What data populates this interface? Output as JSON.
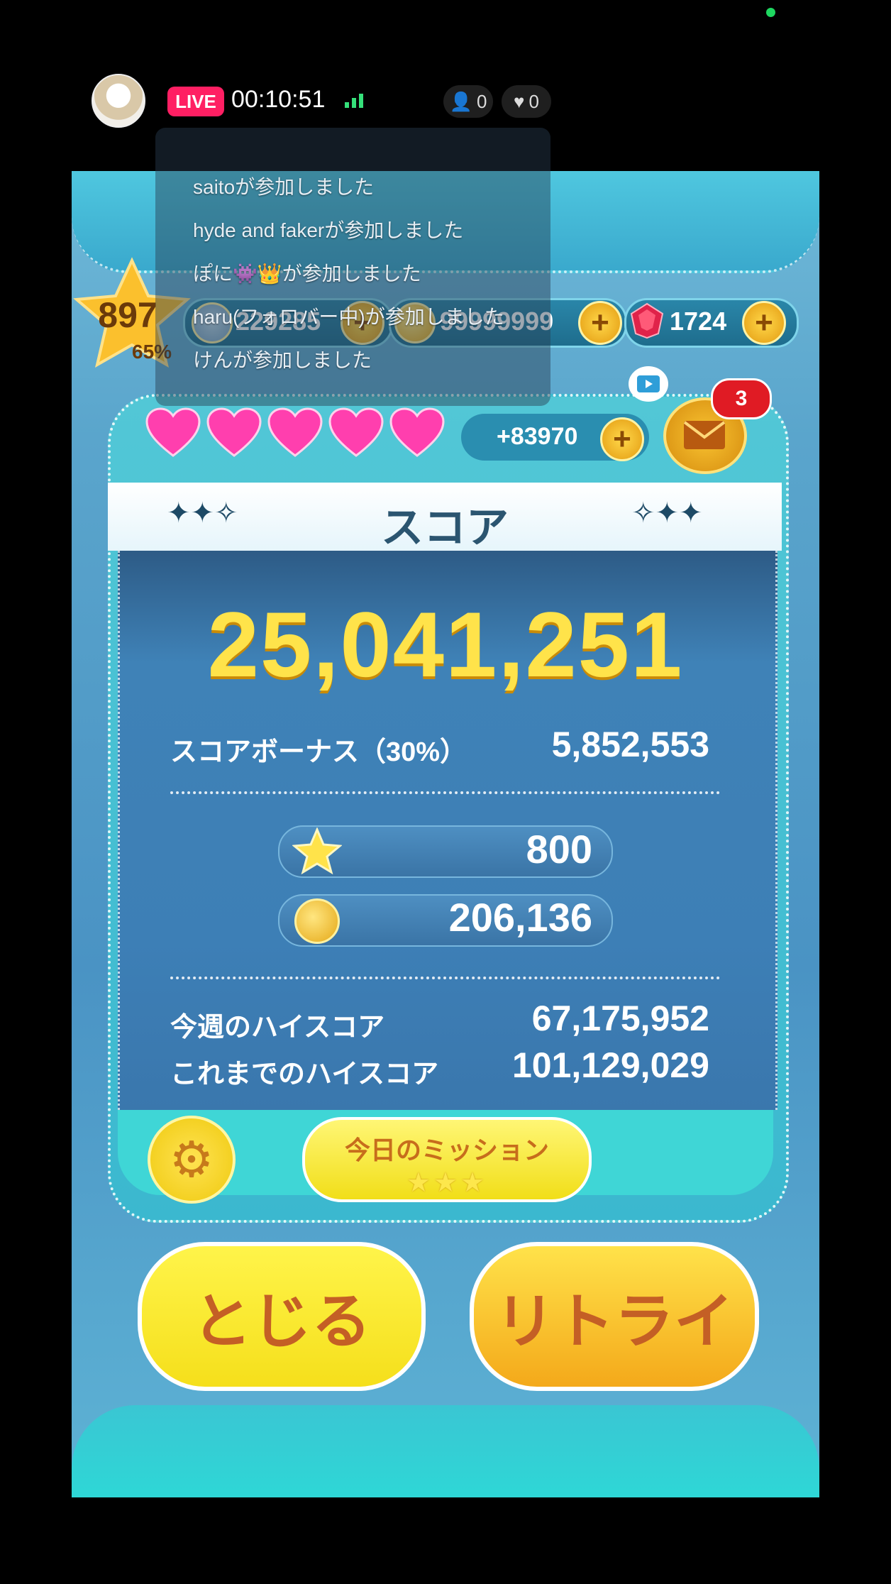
{
  "live": {
    "badge": "LIVE",
    "elapsed": "00:10:51",
    "viewers": "0",
    "likes": "0"
  },
  "chat_messages": [
    "saitoが参加しました",
    "hyde and fakerが参加しました",
    "ぽに👾👑が参加しました",
    "haru(フォロバー中)が参加しました",
    "けんが参加しました"
  ],
  "game": {
    "level": "897",
    "level_progress": "65%",
    "resources": {
      "score_item": "229285",
      "coins": "99999999",
      "gems": "1724"
    },
    "lives_count": 5,
    "life_bonus": "+83970",
    "mail_count": "3",
    "score_title": "スコア",
    "score": "25,041,251",
    "score_bonus_label": "スコアボーナス（30%）",
    "score_bonus_value": "5,852,553",
    "stars_earned": "800",
    "coins_earned": "206,136",
    "weekly_high_label": "今週のハイスコア",
    "weekly_high_value": "67,175,952",
    "all_time_high_label": "これまでのハイスコア",
    "all_time_high_value": "101,129,029",
    "mission_label": "今日のミッション",
    "mission_stars": "★★★",
    "close_label": "とじる",
    "retry_label": "リトライ"
  },
  "colors": {
    "live_red": "#ff1f63",
    "score_yellow": "#ffe34a",
    "button_yellow": "#f5df1b",
    "button_text": "#c45f25"
  }
}
